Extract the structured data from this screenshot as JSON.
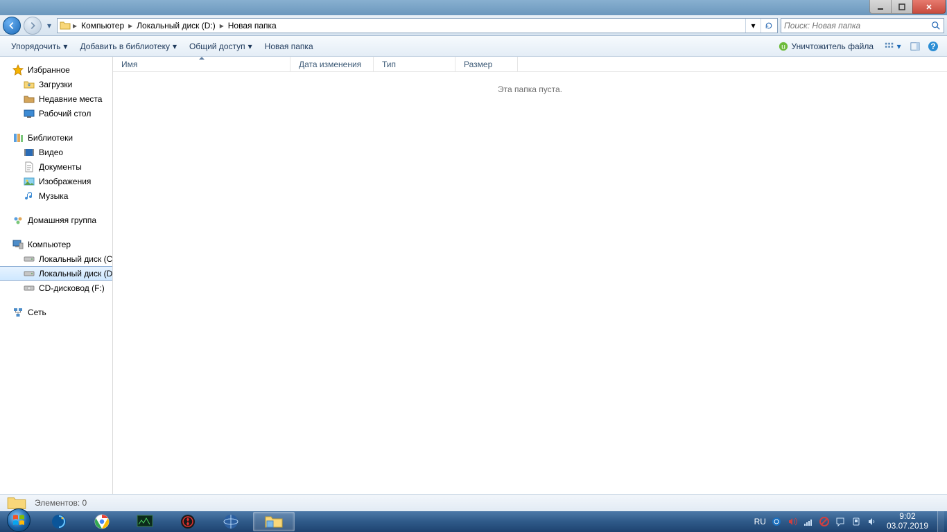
{
  "window_controls": {
    "minimize": "min",
    "maximize": "max",
    "close": "close"
  },
  "nav": {
    "breadcrumbs": [
      "Компьютер",
      "Локальный диск (D:)",
      "Новая папка"
    ],
    "search_placeholder": "Поиск: Новая папка"
  },
  "toolbar": {
    "organize": "Упорядочить",
    "add_library": "Добавить в библиотеку",
    "share": "Общий доступ",
    "new_folder": "Новая папка",
    "file_shredder": "Уничтожитель файла"
  },
  "sidebar": {
    "favorites": {
      "label": "Избранное",
      "items": [
        "Загрузки",
        "Недавние места",
        "Рабочий стол"
      ]
    },
    "libraries": {
      "label": "Библиотеки",
      "items": [
        "Видео",
        "Документы",
        "Изображения",
        "Музыка"
      ]
    },
    "homegroup": {
      "label": "Домашняя группа"
    },
    "computer": {
      "label": "Компьютер",
      "items": [
        "Локальный диск (C:)",
        "Локальный диск (D:)",
        "CD-дисковод (F:)"
      ]
    },
    "network": {
      "label": "Сеть"
    }
  },
  "columns": {
    "name": "Имя",
    "date": "Дата изменения",
    "type": "Тип",
    "size": "Размер"
  },
  "content": {
    "empty": "Эта папка пуста."
  },
  "statusbar": {
    "items": "Элементов: 0"
  },
  "tray": {
    "lang": "RU",
    "time": "9:02",
    "date": "03.07.2019"
  }
}
